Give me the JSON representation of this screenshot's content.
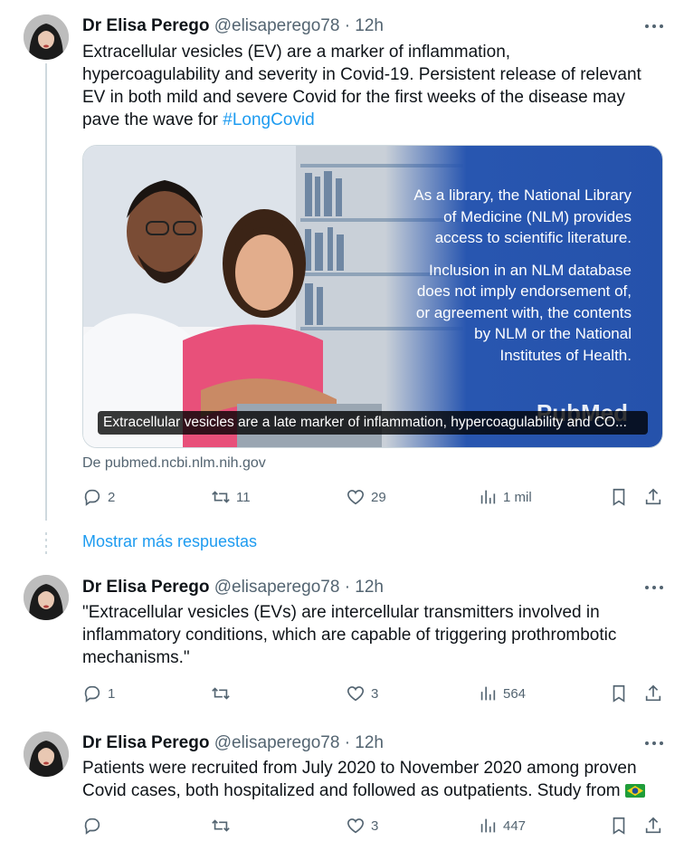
{
  "tweets": [
    {
      "name": "Dr Elisa Perego",
      "handle": "@elisaperego78",
      "separator": "·",
      "time": "12h",
      "text": "Extracellular vesicles (EV) are a marker of inflammation, hypercoagulability and severity in Covid-19. Persistent release of relevant EV in both mild and severe Covid for the first weeks of the disease may pave the wave for",
      "hashtag": "#LongCovid",
      "card": {
        "overlay_lines": [
          "As a library, the National Library",
          "of Medicine (NLM) provides",
          "access to scientific literature.",
          "Inclusion in an NLM database",
          "does not imply endorsement of,",
          "or agreement with, the contents",
          "by NLM or the National",
          "Institutes of Health."
        ],
        "logo_text": "PubMed",
        "caption": "Extracellular vesicles are a late marker of inflammation, hypercoagulability and CO...",
        "source": "De pubmed.ncbi.nlm.nih.gov"
      },
      "replies": "2",
      "retweets": "11",
      "likes": "29",
      "views": "1 mil"
    },
    {
      "name": "Dr Elisa Perego",
      "handle": "@elisaperego78",
      "separator": "·",
      "time": "12h",
      "text": "\"Extracellular vesicles (EVs) are intercellular transmitters involved in inflammatory conditions, which are capable of triggering prothrombotic mechanisms.\"",
      "replies": "1",
      "retweets": "",
      "likes": "3",
      "views": "564"
    },
    {
      "name": "Dr Elisa Perego",
      "handle": "@elisaperego78",
      "separator": "·",
      "time": "12h",
      "text": "Patients were recruited from July 2020 to November 2020 among proven Covid cases, both hospitalized and followed as outpatients. Study from",
      "replies": "",
      "retweets": "",
      "likes": "3",
      "views": "447"
    }
  ],
  "show_more_replies": "Mostrar más respuestas",
  "colors": {
    "accent": "#1d9bf0",
    "muted": "#536471",
    "card_blue": "#2856b0"
  },
  "icons": [
    "reply-icon",
    "retweet-icon",
    "like-icon",
    "views-icon",
    "bookmark-icon",
    "share-icon",
    "more-icon",
    "brazil-flag-icon"
  ]
}
